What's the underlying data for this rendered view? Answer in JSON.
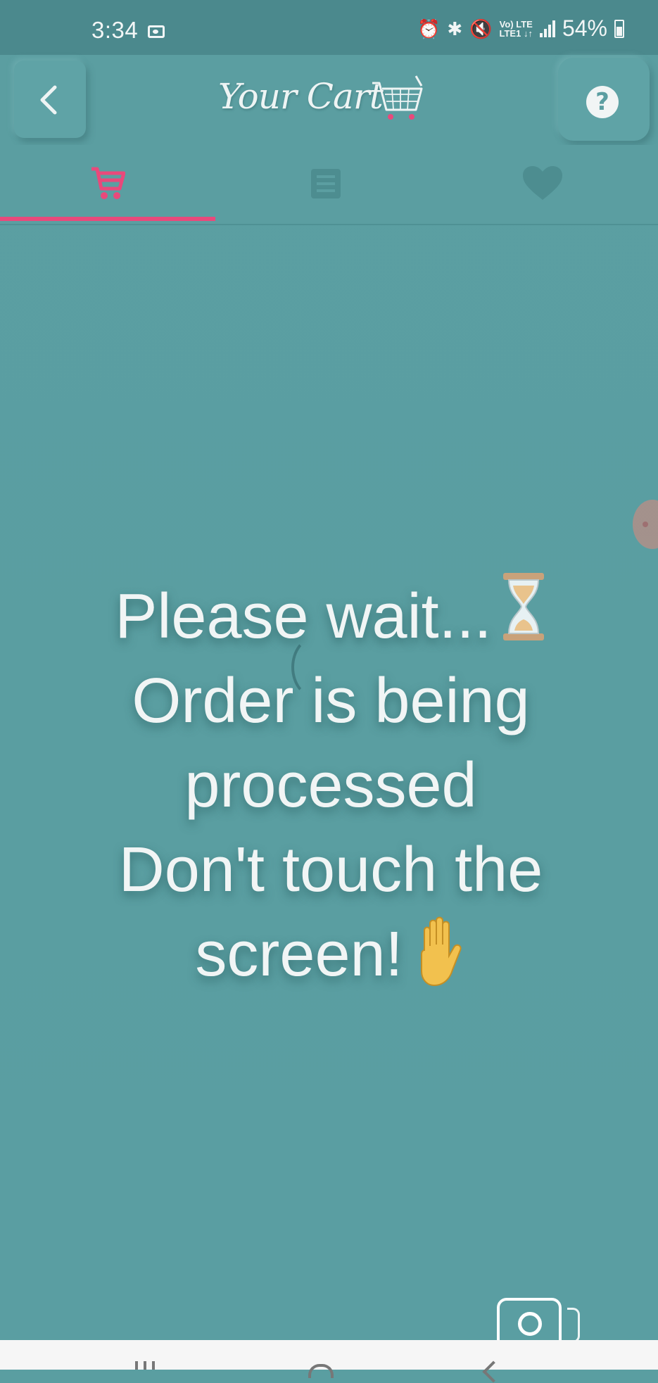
{
  "status_bar": {
    "time": "3:34",
    "network_line1": "Vo) LTE",
    "network_line2": "LTE1 ↓↑",
    "battery": "54%"
  },
  "header": {
    "title": "Your Cart",
    "back_icon": "chevron-left-icon",
    "help_label": "?"
  },
  "tabs": [
    {
      "name": "cart",
      "icon": "cart-icon",
      "active": true,
      "color": "#e9497b"
    },
    {
      "name": "orders",
      "icon": "list-icon",
      "active": false
    },
    {
      "name": "favorites",
      "icon": "heart-icon",
      "active": false
    }
  ],
  "message": {
    "line1": "Please wait...",
    "line2": "Order is being",
    "line3": "processed",
    "line4": "Don't touch the",
    "line5": "screen!"
  },
  "colors": {
    "background": "#5a9ea1",
    "status_bar": "#4b898d",
    "accent": "#e9497b",
    "text": "#f1f5f5"
  }
}
